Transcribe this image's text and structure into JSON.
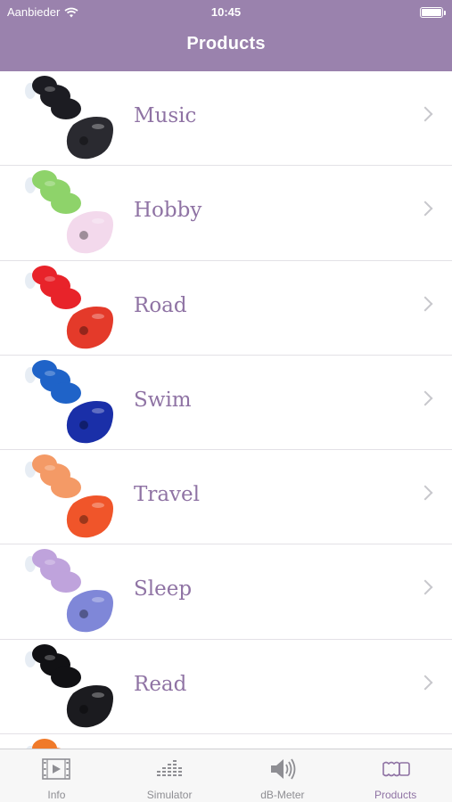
{
  "status_bar": {
    "carrier": "Aanbieder",
    "time": "10:45"
  },
  "nav": {
    "title": "Products"
  },
  "products": [
    {
      "label": "Music",
      "colors": [
        "#1c1c22",
        "#2a2a30"
      ]
    },
    {
      "label": "Hobby",
      "colors": [
        "#8ed36a",
        "#f3d9ec"
      ]
    },
    {
      "label": "Road",
      "colors": [
        "#e8232a",
        "#e43a2a"
      ]
    },
    {
      "label": "Swim",
      "colors": [
        "#1f63c8",
        "#1a2fa8"
      ]
    },
    {
      "label": "Travel",
      "colors": [
        "#f49a66",
        "#f0552a"
      ]
    },
    {
      "label": "Sleep",
      "colors": [
        "#bfa3dc",
        "#7f87d8"
      ]
    },
    {
      "label": "Read",
      "colors": [
        "#111114",
        "#1b1b1f"
      ]
    },
    {
      "label": "",
      "colors": [
        "#f07a2a",
        "#f07a2a"
      ]
    }
  ],
  "tabbar": {
    "items": [
      {
        "label": "Info",
        "icon": "film-icon"
      },
      {
        "label": "Simulator",
        "icon": "equalizer-icon"
      },
      {
        "label": "dB-Meter",
        "icon": "speaker-icon"
      },
      {
        "label": "Products",
        "icon": "earplug-icon"
      }
    ],
    "active": "Products"
  },
  "colors": {
    "accent": "#8f73a4",
    "header": "#9a82ad"
  }
}
